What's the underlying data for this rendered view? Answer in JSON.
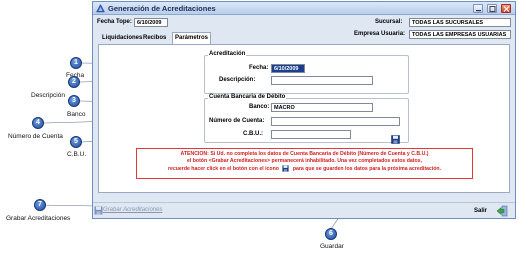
{
  "window": {
    "title": "Generación de Acreditaciones",
    "fecha_tope_label": "Fecha Tope:",
    "fecha_tope_value": "6/10/2009",
    "sucursal_label": "Sucursal:",
    "sucursal_value": "TODAS LAS SUCURSALES",
    "empresa_label": "Empresa Usuaria:",
    "empresa_value": "TODAS LAS EMPRESAS USUARIAS"
  },
  "tabs": [
    {
      "label": "Liquidaciones"
    },
    {
      "label": "Recibos"
    },
    {
      "label": "Parámetros"
    }
  ],
  "acreditacion": {
    "group_title": "Acreditación",
    "fecha_label": "Fecha:",
    "fecha_value": "6/10/2009",
    "descripcion_label": "Descripción:",
    "descripcion_value": ""
  },
  "cuenta": {
    "group_title": "Cuenta Bancaria de Débito",
    "banco_label": "Banco:",
    "banco_value": "MACRO",
    "numero_label": "Número de Cuenta:",
    "numero_value": "",
    "cbu_label": "C.B.U.:",
    "cbu_value": ""
  },
  "warning": {
    "line1": "ATENCION: Si Ud. no completa los datos de Cuenta Bancaria de Débito (Número de Cuenta y C.B.U.)",
    "line2": "el botón <Grabar Acreditaciones> permanecerá inhabilitado. Una vez completados estos datos,",
    "line3a": "recuerde hacer click en el botón con el icono",
    "line3b": "para que se guarden los datos para la próxima acreditación."
  },
  "bottom": {
    "grabar_label": "Grabar Acreditaciones",
    "salir_label": "Salir"
  },
  "callouts": [
    {
      "num": "1",
      "label": "Fecha"
    },
    {
      "num": "2",
      "label": "Descripción"
    },
    {
      "num": "3",
      "label": "Banco"
    },
    {
      "num": "4",
      "label": "Número de Cuenta"
    },
    {
      "num": "5",
      "label": "C.B.U."
    },
    {
      "num": "6",
      "label": "Guardar"
    },
    {
      "num": "7",
      "label": "Grabar Acreditaciones"
    }
  ],
  "colors": {
    "callout": "#1f4c9c",
    "warning": "#d22020",
    "titlebar": "#b9cdea"
  },
  "icons": {
    "save": "floppy-disk-icon",
    "exit": "exit-arrow-icon",
    "app": "app-icon"
  }
}
